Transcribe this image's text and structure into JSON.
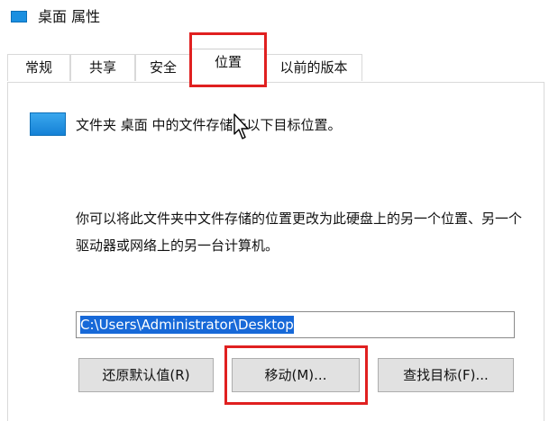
{
  "window": {
    "title": "桌面 属性"
  },
  "tabs": [
    {
      "label": "常规"
    },
    {
      "label": "共享"
    },
    {
      "label": "安全"
    },
    {
      "label": "位置",
      "active": true
    },
    {
      "label": "以前的版本"
    }
  ],
  "location": {
    "info_text": "文件夹 桌面 中的文件存储于以下目标位置。",
    "description": "你可以将此文件夹中文件存储的位置更改为此硬盘上的另一个位置、另一个驱动器或网络上的另一台计算机。",
    "path_value": "C:\\Users\\Administrator\\Desktop"
  },
  "buttons": {
    "restore_default": "还原默认值(R)",
    "move": "移动(M)...",
    "find_target": "查找目标(F)..."
  },
  "icons": {
    "title_icon": "desktop-folder-icon",
    "folder_icon": "desktop-folder-icon",
    "cursor": "mouse-pointer-icon"
  },
  "colors": {
    "highlight_outline": "#e02020",
    "selection": "#1769d8",
    "folder_blue": "#1a8fe0"
  }
}
